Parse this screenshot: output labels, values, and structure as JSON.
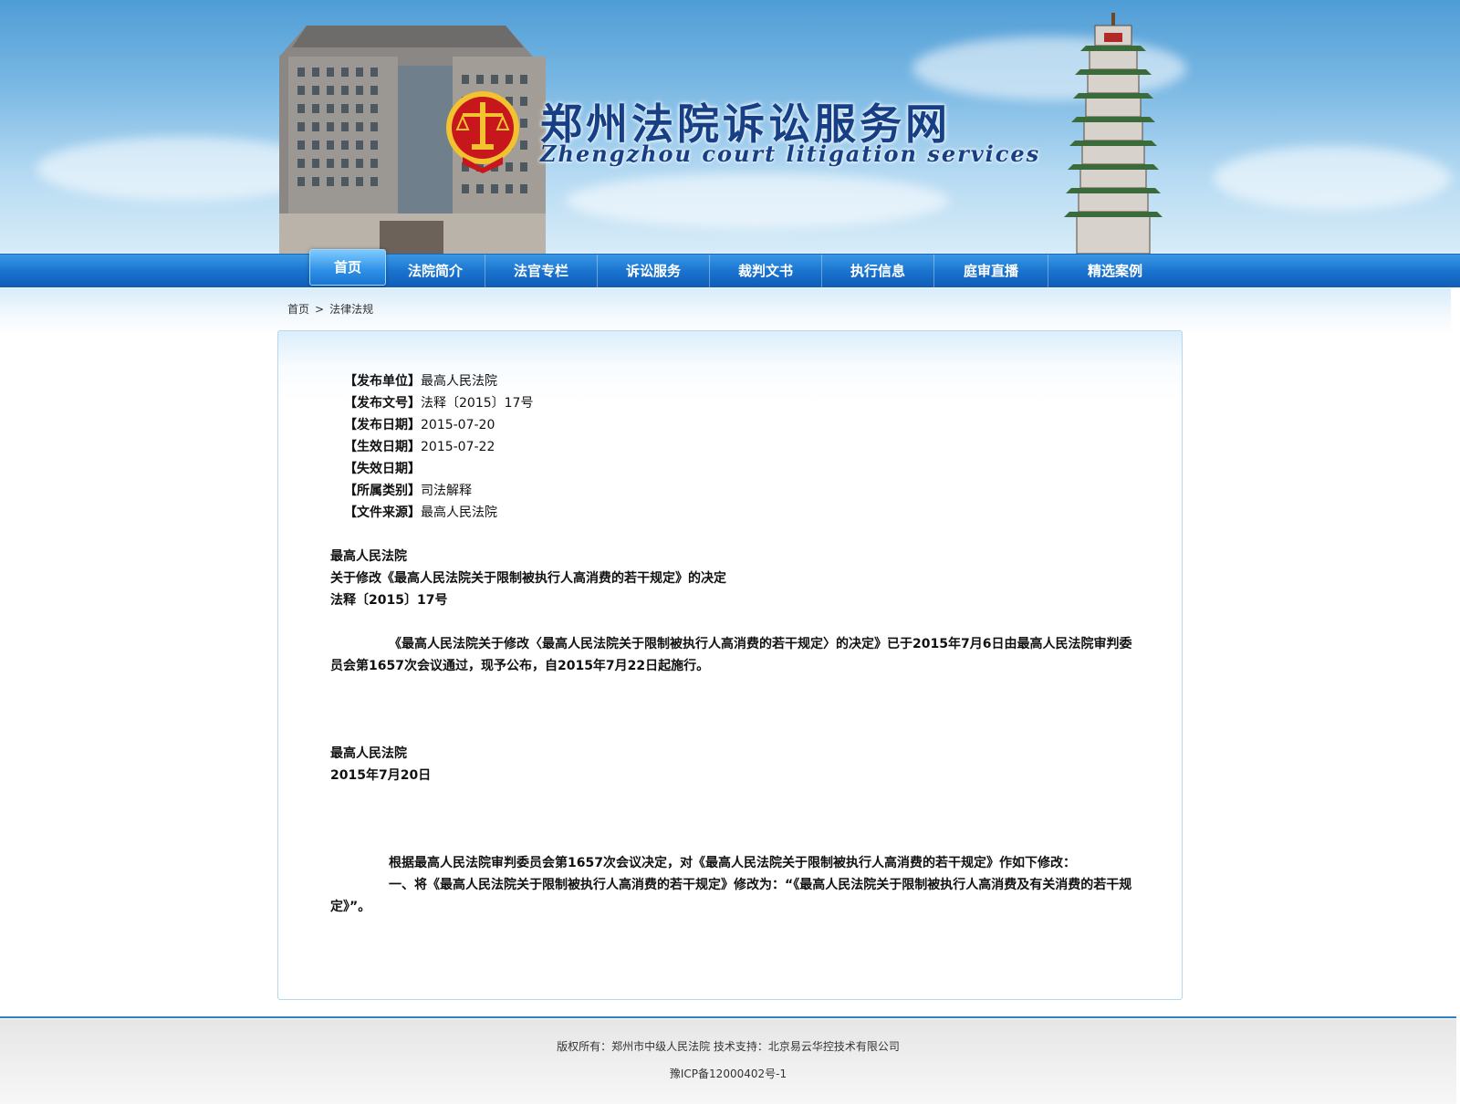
{
  "header": {
    "title": "郑州法院诉讼服务网",
    "subtitle": "Zhengzhou court litigation services"
  },
  "nav": {
    "items": [
      "首页",
      "法院简介",
      "法官专栏",
      "诉讼服务",
      "裁判文书",
      "执行信息",
      "庭审直播",
      "精选案例"
    ],
    "active_index": 0
  },
  "breadcrumb": {
    "home": "首页",
    "separator": ">",
    "current": "法律法规"
  },
  "document": {
    "meta": [
      {
        "key": "【发布单位】",
        "value": "最高人民法院"
      },
      {
        "key": "【发布文号】",
        "value": "法释〔2015〕17号"
      },
      {
        "key": "【发布日期】",
        "value": "2015-07-20"
      },
      {
        "key": "【生效日期】",
        "value": "2015-07-22"
      },
      {
        "key": "【失效日期】",
        "value": ""
      },
      {
        "key": "【所属类别】",
        "value": "司法解释"
      },
      {
        "key": "【文件来源】",
        "value": "最高人民法院"
      }
    ],
    "issuer": "最高人民法院",
    "title": "关于修改《最高人民法院关于限制被执行人高消费的若干规定》的决定",
    "number": "法释〔2015〕17号",
    "announcement": "《最高人民法院关于修改〈最高人民法院关于限制被执行人高消费的若干规定〉的决定》已于2015年7月6日由最高人民法院审判委员会第1657次会议通过，现予公布，自2015年7月22日起施行。",
    "sign_org": "最高人民法院",
    "sign_date": "2015年7月20日",
    "decision_intro": "根据最高人民法院审判委员会第1657次会议决定，对《最高人民法院关于限制被执行人高消费的若干规定》作如下修改：",
    "decision_item1": "一、将《最高人民法院关于限制被执行人高消费的若干规定》修改为：“《最高人民法院关于限制被执行人高消费及有关消费的若干规定》”。"
  },
  "footer": {
    "copyright": "版权所有：郑州市中级人民法院 技术支持：北京易云华控技术有限公司",
    "icp": "豫ICP备12000402号-1"
  },
  "colors": {
    "nav_blue": "#1a74cf",
    "title_blue": "#163f86",
    "emblem_red": "#c8161d",
    "emblem_gold": "#f2c230"
  }
}
